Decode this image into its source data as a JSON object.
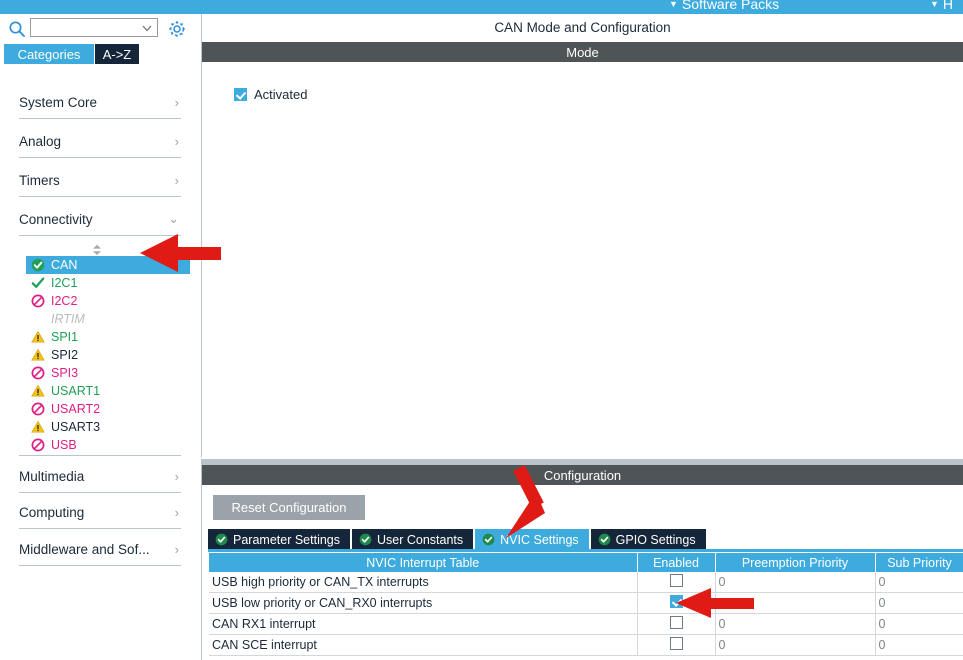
{
  "topbar": {
    "items": [
      {
        "id": "software-packs",
        "label": "Software Packs"
      },
      {
        "id": "help",
        "label": "H"
      }
    ]
  },
  "sidebar": {
    "search": {
      "value": "",
      "placeholder": ""
    },
    "gear_title": "Settings",
    "tabs": [
      {
        "id": "categories",
        "label": "Categories",
        "active": true
      },
      {
        "id": "a-to-z",
        "label": "A->Z",
        "active": false
      }
    ],
    "categories": [
      {
        "label": "System Core",
        "chevron": "›",
        "expanded": false
      },
      {
        "label": "Analog",
        "chevron": "›",
        "expanded": false
      },
      {
        "label": "Timers",
        "chevron": "›",
        "expanded": false
      },
      {
        "label": "Connectivity",
        "chevron": "⌄",
        "expanded": true
      }
    ],
    "categories_bottom": [
      {
        "label": "Multimedia",
        "chevron": "›",
        "expanded": false
      },
      {
        "label": "Computing",
        "chevron": "›",
        "expanded": false
      },
      {
        "label": "Middleware and Sof...",
        "chevron": "›",
        "expanded": false
      }
    ],
    "peripherals": [
      {
        "label": "CAN",
        "icon": "check-circle-green-icon",
        "state": "selected"
      },
      {
        "label": "I2C1",
        "icon": "check-green-icon",
        "state": "ok"
      },
      {
        "label": "I2C2",
        "icon": "forbidden-pink-icon",
        "state": "unavailable"
      },
      {
        "label": "IRTIM",
        "icon": "none",
        "state": "disabled"
      },
      {
        "label": "SPI1",
        "icon": "warning-yellow-icon",
        "state": "warning-ok"
      },
      {
        "label": "SPI2",
        "icon": "warning-yellow-icon",
        "state": "warning"
      },
      {
        "label": "SPI3",
        "icon": "forbidden-pink-icon",
        "state": "unavailable"
      },
      {
        "label": "USART1",
        "icon": "warning-yellow-icon",
        "state": "warning-ok"
      },
      {
        "label": "USART2",
        "icon": "forbidden-pink-icon",
        "state": "unavailable"
      },
      {
        "label": "USART3",
        "icon": "warning-yellow-icon",
        "state": "warning"
      },
      {
        "label": "USB",
        "icon": "forbidden-pink-icon",
        "state": "unavailable"
      }
    ]
  },
  "mode_panel": {
    "title": "CAN Mode and Configuration",
    "section_label": "Mode",
    "activated": {
      "label": "Activated",
      "checked": true
    }
  },
  "config_panel": {
    "section_label": "Configuration",
    "reset_label": "Reset Configuration",
    "tabs": [
      {
        "id": "parameter-settings",
        "label": "Parameter Settings",
        "active": false
      },
      {
        "id": "user-constants",
        "label": "User Constants",
        "active": false
      },
      {
        "id": "nvic-settings",
        "label": "NVIC Settings",
        "active": true
      },
      {
        "id": "gpio-settings",
        "label": "GPIO Settings",
        "active": false
      }
    ],
    "nvic_table": {
      "headers": [
        "NVIC Interrupt Table",
        "Enabled",
        "Preemption Priority",
        "Sub Priority"
      ],
      "rows": [
        {
          "name": "USB high priority or CAN_TX interrupts",
          "enabled": false,
          "preemption": "0",
          "sub": "0"
        },
        {
          "name": "USB low priority or CAN_RX0 interrupts",
          "enabled": true,
          "preemption": "0",
          "sub": "0"
        },
        {
          "name": "CAN RX1 interrupt",
          "enabled": false,
          "preemption": "0",
          "sub": "0"
        },
        {
          "name": "CAN SCE interrupt",
          "enabled": false,
          "preemption": "0",
          "sub": "0"
        }
      ]
    }
  },
  "annotations": {
    "arrow_color": "#e01b16",
    "arrows": [
      {
        "id": "arrow-to-can-item",
        "target": "CAN"
      },
      {
        "id": "arrow-to-nvic-tab",
        "target": "NVIC Settings"
      },
      {
        "id": "arrow-to-enabled-checkbox",
        "target": "USB low priority or CAN_RX0 interrupts Enabled"
      }
    ]
  },
  "colors": {
    "accent_blue": "#3dabdd",
    "dark_navy": "#16263a",
    "section_grey": "#4f5456",
    "ok_green": "#1f9e56",
    "error_pink": "#e01e84",
    "warn_yellow": "#f5c518"
  }
}
